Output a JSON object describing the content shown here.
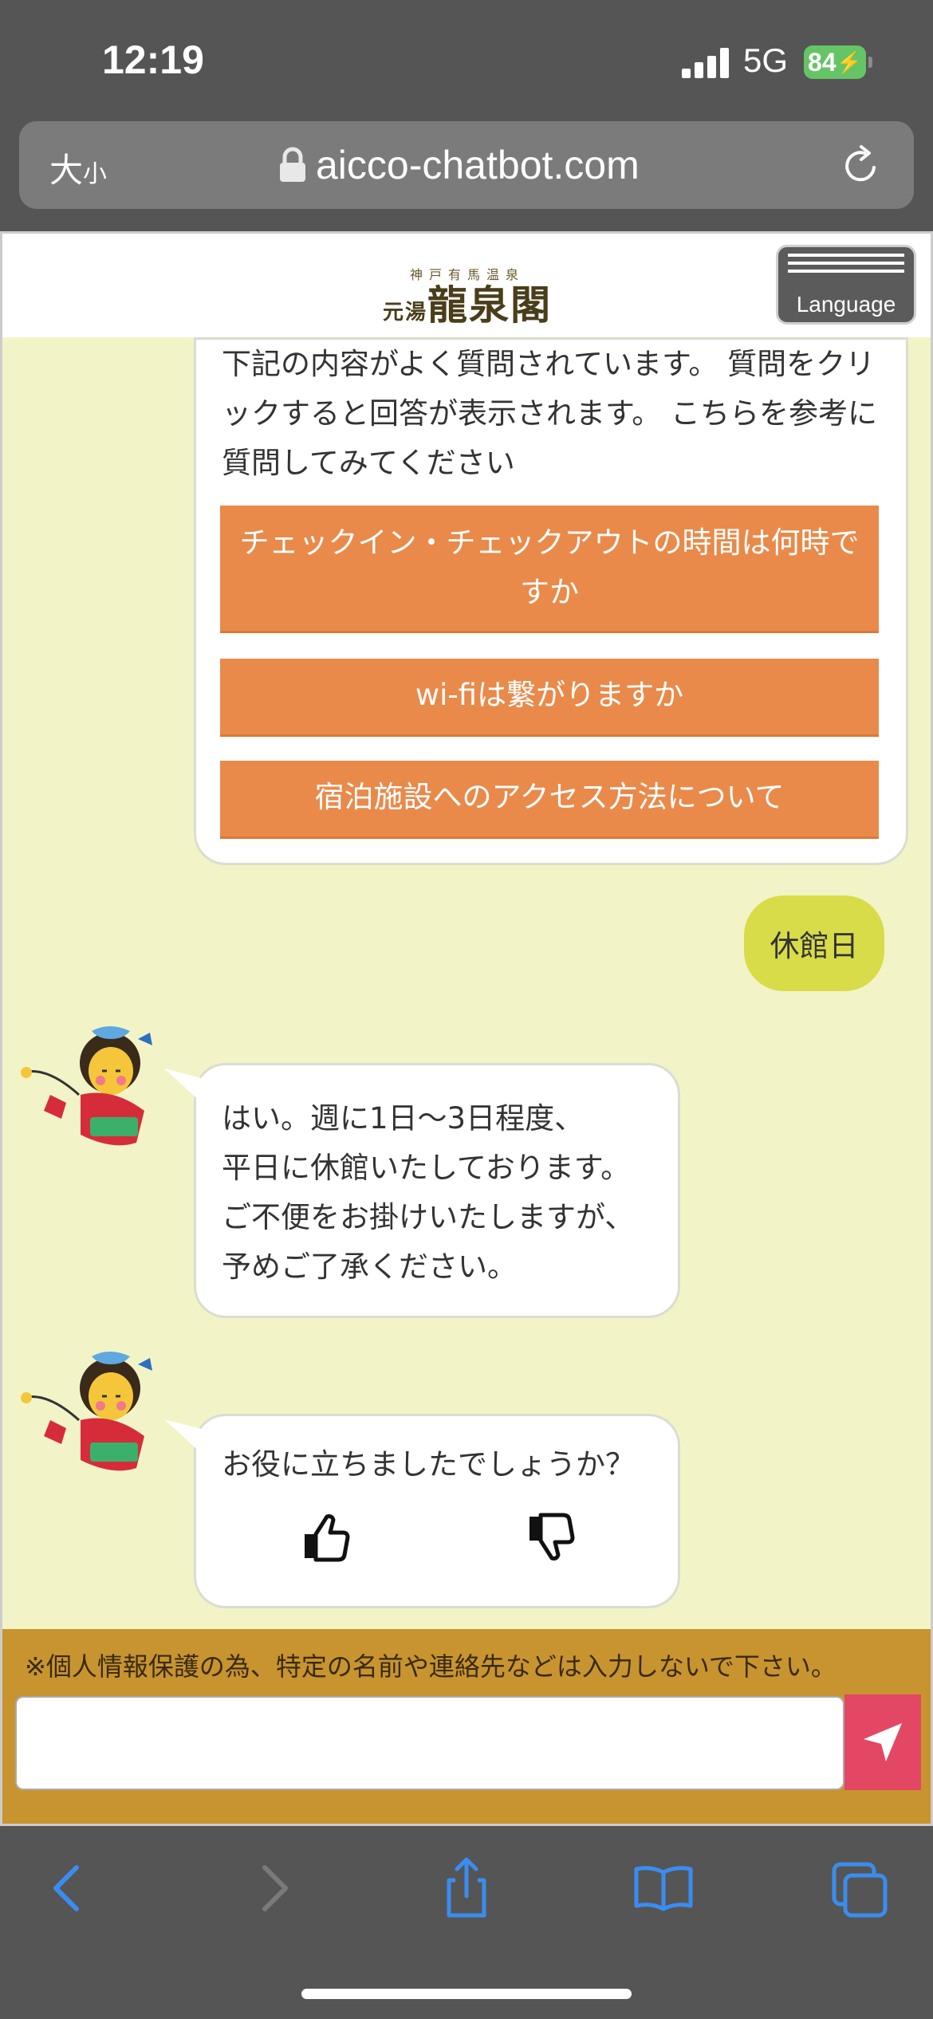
{
  "status_bar": {
    "time": "12:19",
    "network": "5G",
    "battery": "84"
  },
  "browser": {
    "text_size_label": "大",
    "text_size_small": "小",
    "url": "aicco-chatbot.com"
  },
  "site": {
    "logo_top": "神戸有馬温泉",
    "logo_prefix": "元湯",
    "logo_main": "龍泉閣",
    "language_label": "Language"
  },
  "chat": {
    "faq_intro": "下記の内容がよく質問されています。 質問をクリックすると回答が表示されます。 こちらを参考に質問してみてください",
    "faq_buttons": [
      "チェックイン・チェックアウトの時間は何時ですか",
      "wi-fiは繋がりますか",
      "宿泊施設へのアクセス方法について"
    ],
    "user_message": "休館日",
    "bot_answer_lines": [
      "はい。週に1日〜3日程度、",
      "平日に休館いたしております。",
      "ご不便をお掛けいたしますが、",
      "予めご了承ください。"
    ],
    "feedback_question": "お役に立ちましたでしょうか？"
  },
  "footer": {
    "notice": "※個人情報保護の為、特定の名前や連絡先などは入力しないで下さい。",
    "input_placeholder": ""
  },
  "colors": {
    "chat_background": "#f2f4c8",
    "faq_button": "#e98a4a",
    "user_bubble": "#d8dc48",
    "footer": "#c89430",
    "send_button": "#e34763",
    "toolbar_icon": "#3a8df0"
  },
  "icons": {
    "lock": "lock-icon",
    "reload": "reload-icon",
    "thumbs_up": "thumbs-up-icon",
    "thumbs_down": "thumbs-down-icon",
    "send": "paper-plane-icon",
    "back": "back-arrow-icon",
    "forward": "forward-arrow-icon",
    "share": "share-icon",
    "bookmarks": "book-icon",
    "tabs": "tabs-icon"
  }
}
